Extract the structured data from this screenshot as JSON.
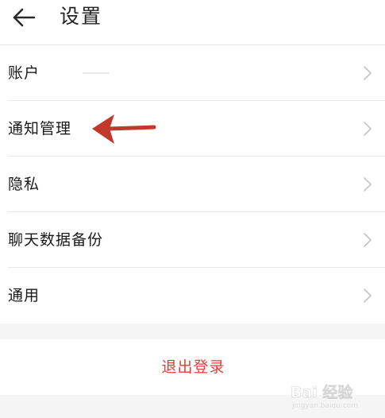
{
  "header": {
    "title": "设置",
    "back_icon": "arrow-left-icon"
  },
  "settings": {
    "items": [
      {
        "label": "账户"
      },
      {
        "label": "通知管理"
      },
      {
        "label": "隐私"
      },
      {
        "label": "聊天数据备份"
      },
      {
        "label": "通用"
      }
    ],
    "chevron_icon": "chevron-right-icon"
  },
  "logout": {
    "label": "退出登录"
  },
  "annotation": {
    "icon": "arrow-left-icon",
    "color": "#c0392b"
  },
  "watermark": {
    "brand": "Bai 经验",
    "domain": "jingyan.baidu.com"
  },
  "colors": {
    "accent": "#d9403a",
    "background": "#f5f5f5"
  }
}
